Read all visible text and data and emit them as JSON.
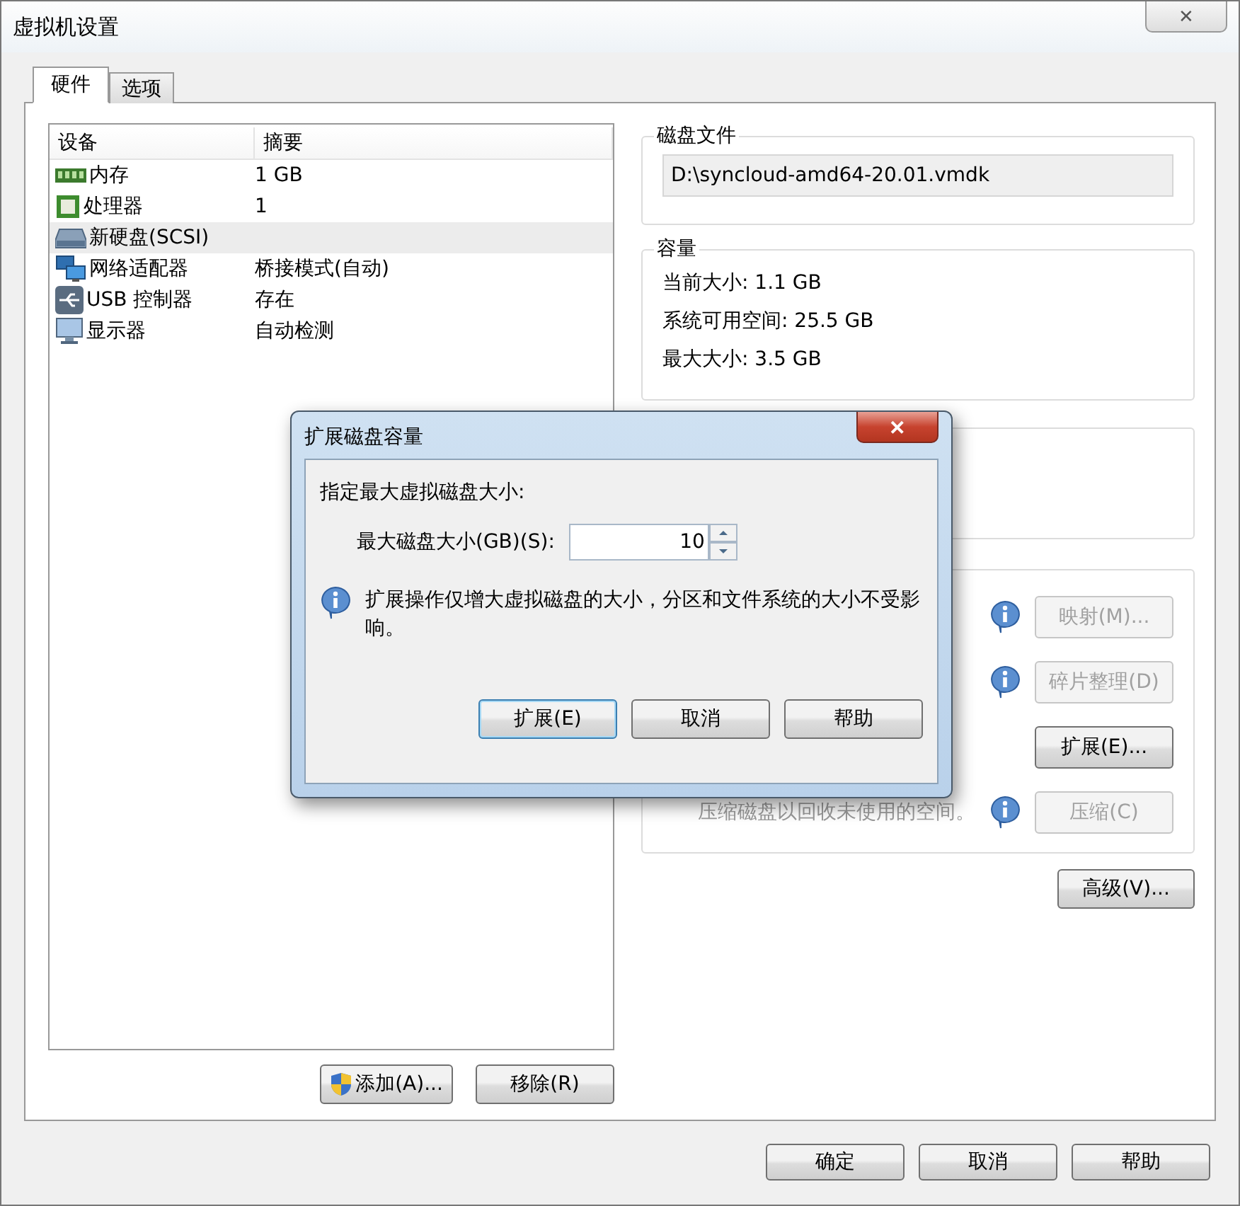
{
  "window": {
    "title": "虚拟机设置",
    "close": "✕"
  },
  "tabs": [
    {
      "label": "硬件",
      "selected": true
    },
    {
      "label": "选项",
      "selected": false
    }
  ],
  "device_list": {
    "columns": [
      "设备",
      "摘要"
    ],
    "rows": [
      {
        "kind": "memory",
        "device": "内存",
        "summary": "1 GB",
        "selected": false
      },
      {
        "kind": "cpu",
        "device": "处理器",
        "summary": "1",
        "selected": false
      },
      {
        "kind": "disk",
        "device": "新硬盘(SCSI)",
        "selected": true
      },
      {
        "kind": "network",
        "device": "网络适配器",
        "summary": "桥接模式(自动)",
        "selected": false
      },
      {
        "kind": "usb",
        "device": "USB 控制器",
        "summary": "存在",
        "selected": false
      },
      {
        "kind": "display",
        "device": "显示器",
        "summary": "自动检测",
        "selected": false
      }
    ]
  },
  "list_buttons": [
    {
      "label": "添加(A)...",
      "kind": "shield"
    },
    {
      "label": "移除(R)",
      "kind": "plain"
    }
  ],
  "disk_file": {
    "title": "磁盘文件",
    "value": "D:\\syncloud-amd64-20.01.vmdk"
  },
  "capacity": {
    "title": "容量",
    "lines": [
      "当前大小: 1.1 GB",
      "系统可用空间: 25.5 GB",
      "最大大小: 3.5 GB"
    ]
  },
  "utilities": [
    {
      "info": true,
      "label": "映射(M)...",
      "disabled": true
    },
    {
      "info": true,
      "label": "碎片整理(D)",
      "disabled": true
    },
    {
      "info": false,
      "label": "扩展(E)...",
      "disabled": false
    },
    {
      "description": "压缩磁盘以回收未使用的空间。",
      "info": true,
      "label": "压缩(C)",
      "disabled": true
    }
  ],
  "advanced_button": "高级(V)...",
  "footer_buttons": [
    "确定",
    "取消",
    "帮助"
  ],
  "dialog": {
    "title": "扩展磁盘容量",
    "close": "✕",
    "prompt": "指定最大虚拟磁盘大小:",
    "field_label": "最大磁盘大小(GB)(S):",
    "value": "10",
    "note": "扩展操作仅增大虚拟磁盘的大小，分区和文件系统的大小不受影响。",
    "buttons": [
      {
        "label": "扩展(E)",
        "default": true
      },
      {
        "label": "取消",
        "default": false
      },
      {
        "label": "帮助",
        "default": false
      }
    ]
  }
}
